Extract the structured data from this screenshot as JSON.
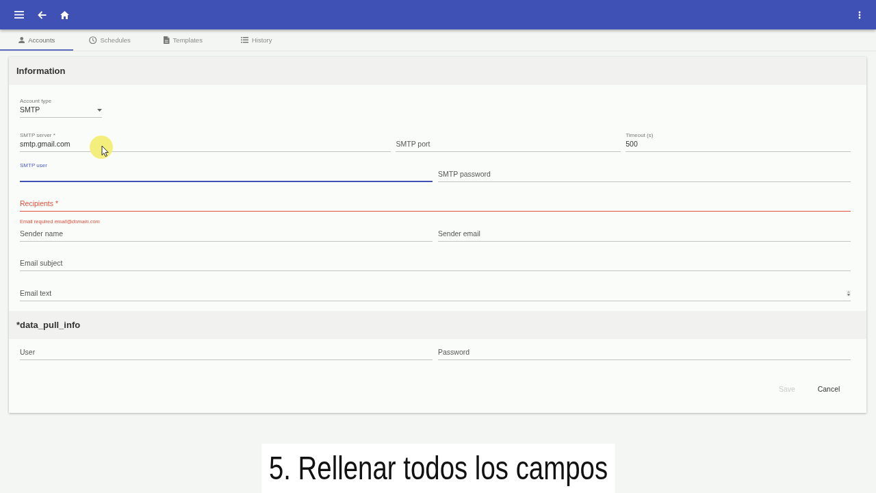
{
  "tabs": [
    {
      "label": "Accounts",
      "selected": true
    },
    {
      "label": "Schedules",
      "selected": false
    },
    {
      "label": "Templates",
      "selected": false
    },
    {
      "label": "History",
      "selected": false
    }
  ],
  "sections": [
    {
      "title": "Information",
      "rows": [
        [
          {
            "kind": "select",
            "label": "Account type",
            "value": "SMTP",
            "focused": false,
            "invalid": false
          }
        ],
        [
          {
            "kind": "text",
            "label": "SMTP server *",
            "value": "smtp.gmail.com",
            "focused": false,
            "invalid": false
          },
          {
            "kind": "text",
            "placeholder": "SMTP port",
            "focused": false,
            "invalid": false
          },
          {
            "kind": "text",
            "label": "Timeout (s)",
            "value": "500",
            "focused": false,
            "invalid": false
          }
        ],
        [
          {
            "kind": "text",
            "label": "SMTP user",
            "focused": true,
            "invalid": false
          },
          {
            "kind": "text",
            "placeholder": "SMTP password",
            "focused": false,
            "invalid": false
          }
        ],
        [
          {
            "kind": "text",
            "placeholder": "Recipients *",
            "focused": false,
            "invalid": true,
            "error": "Email required *email@domain.com*"
          }
        ],
        [
          {
            "kind": "text",
            "placeholder": "Sender name",
            "focused": false,
            "invalid": false
          },
          {
            "kind": "text",
            "placeholder": "Sender email",
            "focused": false,
            "invalid": false
          }
        ],
        [
          {
            "kind": "text",
            "placeholder": "Email subject",
            "focused": false,
            "invalid": false
          }
        ],
        [
          {
            "kind": "textarea",
            "placeholder": "Email text",
            "focused": false,
            "invalid": false
          }
        ]
      ]
    },
    {
      "title": "*data_pull_info",
      "rows": [
        [
          {
            "kind": "text",
            "placeholder": "User",
            "focused": false,
            "invalid": false
          },
          {
            "kind": "text",
            "placeholder": "Password",
            "focused": false,
            "invalid": false
          }
        ]
      ]
    }
  ],
  "actions": [
    {
      "label": "Save",
      "disabled": true
    },
    {
      "label": "Cancel",
      "disabled": false
    }
  ],
  "caption": "5. Rellenar todos los campos"
}
